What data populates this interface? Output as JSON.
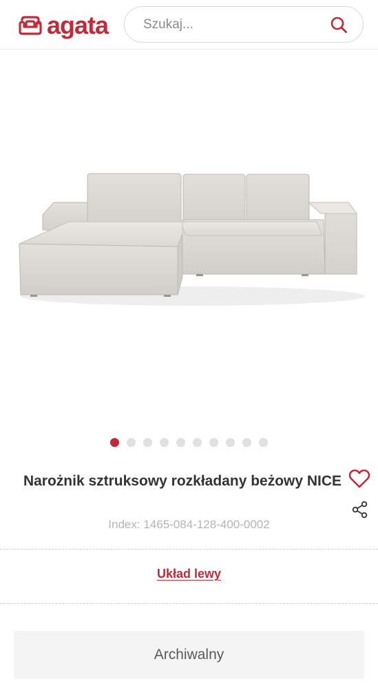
{
  "header": {
    "logo_text": "agata",
    "search": {
      "placeholder": "Szukaj..."
    }
  },
  "brand": {
    "accent_color": "#c22a3a"
  },
  "gallery": {
    "image_alt": "",
    "slide_count": 10,
    "active_slide": 1
  },
  "product": {
    "title": "Narożnik sztruksowy rozkładany beżowy NICE",
    "index": "Index: 1465-084-128-400-0002",
    "layout_label": "Układ lewy",
    "status": "Archiwalny"
  },
  "icons": {
    "logo": "sofa-logo-icon",
    "search": "search-icon",
    "favorite": "heart-icon",
    "share": "share-icon"
  }
}
